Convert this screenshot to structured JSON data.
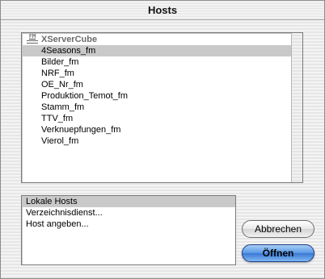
{
  "window": {
    "title": "Hosts"
  },
  "hosts": {
    "group_label": "XServerCube",
    "group_icon": "filemaker-server-icon",
    "items": [
      {
        "label": "4Seasons_fm",
        "selected": true
      },
      {
        "label": "Bilder_fm",
        "selected": false
      },
      {
        "label": "NRF_fm",
        "selected": false
      },
      {
        "label": "OE_Nr_fm",
        "selected": false
      },
      {
        "label": "Produktion_Temot_fm",
        "selected": false
      },
      {
        "label": "Stamm_fm",
        "selected": false
      },
      {
        "label": "TTV_fm",
        "selected": false
      },
      {
        "label": "Verknuepfungen_fm",
        "selected": false
      },
      {
        "label": "Vierol_fm",
        "selected": false
      }
    ]
  },
  "sources": {
    "items": [
      {
        "label": "Lokale Hosts",
        "selected": true
      },
      {
        "label": "Verzeichnisdienst...",
        "selected": false
      },
      {
        "label": "Host angeben...",
        "selected": false
      }
    ]
  },
  "buttons": {
    "cancel": "Abbrechen",
    "open": "Öffnen"
  },
  "colors": {
    "selection": "#c9c9c9",
    "default_button": "#5b9be6"
  }
}
